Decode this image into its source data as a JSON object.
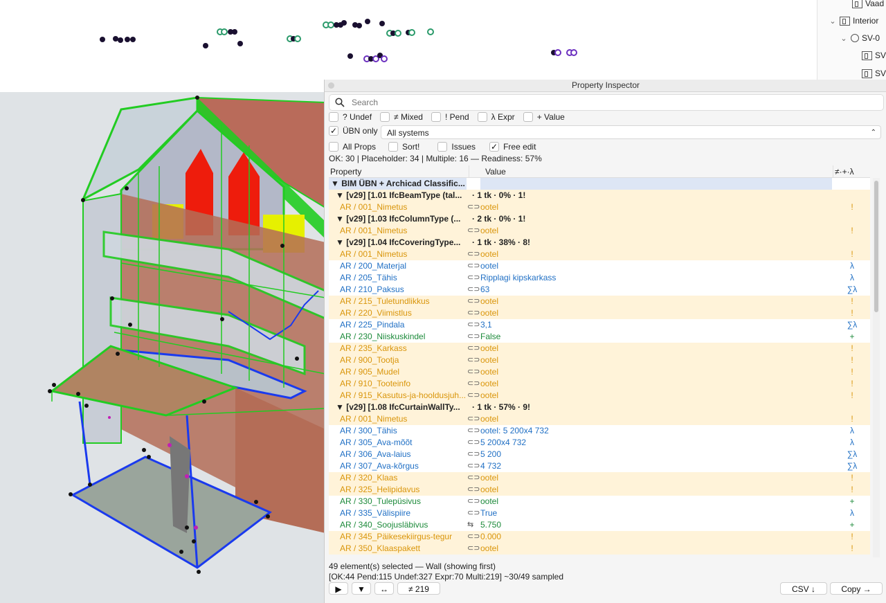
{
  "tree": {
    "items": [
      {
        "label": "Vaad",
        "indent": 2
      },
      {
        "label": "Interior",
        "indent": 1
      },
      {
        "label": "SV-0",
        "indent": 2
      },
      {
        "label": "SV",
        "indent": 3
      },
      {
        "label": "SV",
        "indent": 3
      }
    ]
  },
  "inspector": {
    "title": "Property Inspector",
    "search_placeholder": "Search",
    "filters": [
      {
        "label": "? Undef",
        "checked": false
      },
      {
        "label": "≠ Mixed",
        "checked": false
      },
      {
        "label": "! Pend",
        "checked": false
      },
      {
        "label": "λ Expr",
        "checked": false
      },
      {
        "label": "+ Value",
        "checked": false
      }
    ],
    "ubn_only": {
      "label": "ÜBN only",
      "checked": true
    },
    "system_select": "All systems",
    "options": [
      {
        "label": "All Props",
        "checked": false
      },
      {
        "label": "Sort!",
        "checked": false
      },
      {
        "label": "Issues",
        "checked": false
      },
      {
        "label": "Free edit",
        "checked": true
      }
    ],
    "summary": "OK: 30 | Placeholder: 34 | Multiple: 16 — Readiness: 57%",
    "columns": [
      "Property",
      "Value",
      "≠·+·λ"
    ],
    "rows": [
      {
        "type": "root",
        "name": "▼ BIM ÜBN + Archicad Classific...",
        "value": "",
        "flag": ""
      },
      {
        "type": "group",
        "name": "▼ [v29] [1.01 IfcBeamType (tal...",
        "value": "· 1 tk  ·  0%  ·  1!",
        "flag": ""
      },
      {
        "type": "prop",
        "name": "AR / 001_Nimetus",
        "value": "ootel",
        "flag": "!",
        "color": "o"
      },
      {
        "type": "group",
        "name": "▼ [v29] [1.03 IfcColumnType (...",
        "value": "· 2 tk  ·  0%  ·  1!",
        "flag": ""
      },
      {
        "type": "prop",
        "name": "AR / 001_Nimetus",
        "value": "ootel",
        "flag": "!",
        "color": "o"
      },
      {
        "type": "group",
        "name": "▼ [v29] [1.04 IfcCoveringType...",
        "value": "· 1 tk  ·  38%  ·  8!",
        "flag": ""
      },
      {
        "type": "prop",
        "name": "AR / 001_Nimetus",
        "value": "ootel",
        "flag": "!",
        "color": "o"
      },
      {
        "type": "prop",
        "name": "AR / 200_Materjal",
        "value": "ootel",
        "flag": "λ",
        "color": "b"
      },
      {
        "type": "prop",
        "name": "AR / 205_Tähis",
        "value": "Ripplagi kipskarkass",
        "flag": "λ",
        "color": "b"
      },
      {
        "type": "prop",
        "name": "AR / 210_Paksus",
        "value": "63",
        "flag": "∑λ",
        "color": "b"
      },
      {
        "type": "prop",
        "name": "AR / 215_Tuletundlikkus",
        "value": "ootel",
        "flag": "!",
        "color": "o"
      },
      {
        "type": "prop",
        "name": "AR / 220_Viimistlus",
        "value": "ootel",
        "flag": "!",
        "color": "o"
      },
      {
        "type": "prop",
        "name": "AR / 225_Pindala",
        "value": "3,1",
        "flag": "∑λ",
        "color": "b"
      },
      {
        "type": "prop",
        "name": "AR / 230_Niiskuskindel",
        "value": "False",
        "flag": "+",
        "color": "g"
      },
      {
        "type": "prop",
        "name": "AR / 235_Karkass",
        "value": "ootel",
        "flag": "!",
        "color": "o"
      },
      {
        "type": "prop",
        "name": "AR / 900_Tootja",
        "value": "ootel",
        "flag": "!",
        "color": "o"
      },
      {
        "type": "prop",
        "name": "AR / 905_Mudel",
        "value": "ootel",
        "flag": "!",
        "color": "o"
      },
      {
        "type": "prop",
        "name": "AR / 910_Tooteinfo",
        "value": "ootel",
        "flag": "!",
        "color": "o"
      },
      {
        "type": "prop",
        "name": "AR / 915_Kasutus-ja-hooldusjuh...",
        "value": "ootel",
        "flag": "!",
        "color": "o"
      },
      {
        "type": "group",
        "name": "▼ [v29] [1.08 IfcCurtainWallTy...",
        "value": "· 1 tk  ·  57%  ·  9!",
        "flag": ""
      },
      {
        "type": "prop",
        "name": "AR / 001_Nimetus",
        "value": "ootel",
        "flag": "!",
        "color": "o"
      },
      {
        "type": "prop",
        "name": "AR / 300_Tähis",
        "value": "ootel: 5 200x4 732",
        "flag": "λ",
        "color": "b"
      },
      {
        "type": "prop",
        "name": "AR / 305_Ava-mõõt",
        "value": "5 200x4 732",
        "flag": "λ",
        "color": "b"
      },
      {
        "type": "prop",
        "name": "AR / 306_Ava-laius",
        "value": "5 200",
        "flag": "∑λ",
        "color": "b"
      },
      {
        "type": "prop",
        "name": "AR / 307_Ava-kõrgus",
        "value": "4 732",
        "flag": "∑λ",
        "color": "b"
      },
      {
        "type": "prop",
        "name": "AR / 320_Klaas",
        "value": "ootel",
        "flag": "!",
        "color": "o"
      },
      {
        "type": "prop",
        "name": "AR / 325_Helipidavus",
        "value": "ootel",
        "flag": "!",
        "color": "o"
      },
      {
        "type": "prop",
        "name": "AR / 330_Tulepüsivus",
        "value": "ootel",
        "flag": "+",
        "color": "g"
      },
      {
        "type": "prop",
        "name": "AR / 335_Välispiire",
        "value": "True",
        "flag": "λ",
        "color": "b"
      },
      {
        "type": "prop",
        "name": "AR / 340_Soojusläbivus",
        "value": "5.750",
        "flag": "+",
        "color": "g"
      },
      {
        "type": "prop",
        "name": "AR / 345_Päikesekiirgus-tegur",
        "value": "0.000",
        "flag": "!",
        "color": "o"
      },
      {
        "type": "prop",
        "name": "AR / 350_Klaaspakett",
        "value": "ootel",
        "flag": "!",
        "color": "o"
      }
    ],
    "status_line1": "49 element(s) selected — Wall (showing first)",
    "status_line2": "[OK:44 Pend:115 Undef:327 Expr:70 Multi:219]  ~30/49 sampled",
    "buttons": {
      "play": "▶",
      "down": "▼",
      "swap": "↔",
      "diff": "≠ 219",
      "csv": "CSV ↓",
      "copy": "Copy →"
    }
  },
  "colors": {
    "placeholder": "#d9950a",
    "expression": "#1f6fc4",
    "value": "#1c8a3a",
    "wireframe": "#22cc22"
  }
}
